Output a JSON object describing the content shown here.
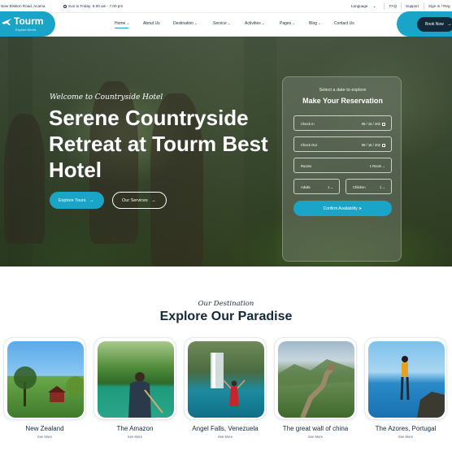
{
  "topbar": {
    "address": "New Elskton Road, Acama",
    "hours": "Sun to Friday: 8.00 am - 7.00 pm",
    "language": "Language",
    "faq": "FAQ",
    "support": "Support",
    "signin": "Sign In / Reg"
  },
  "logo": {
    "title": "Tourm",
    "tagline": "Explore World"
  },
  "nav": [
    {
      "label": "Home",
      "dropdown": true
    },
    {
      "label": "About Us",
      "dropdown": false
    },
    {
      "label": "Destination",
      "dropdown": true
    },
    {
      "label": "Service",
      "dropdown": true
    },
    {
      "label": "Activities",
      "dropdown": true
    },
    {
      "label": "Pages",
      "dropdown": true
    },
    {
      "label": "Blog",
      "dropdown": true
    },
    {
      "label": "Contact Us",
      "dropdown": false
    }
  ],
  "book_now": "Book Now",
  "hero": {
    "welcome": "Welcome to Countryside Hotel",
    "title": "Serene Countryside Retreat at Tourm Best Hotel",
    "explore_btn": "Explore Tours",
    "services_btn": "Our Services"
  },
  "reservation": {
    "subtitle": "Select a date to explore",
    "title": "Make Your Reservation",
    "check_in_label": "Check In",
    "check_in_value": "09 / 15 / 202",
    "check_out_label": "Check Out",
    "check_out_value": "09 / 16 / 202",
    "rooms_label": "Rooms",
    "rooms_value": "1 Room",
    "adults_label": "Adults",
    "adults_value": "1",
    "children_label": "Children",
    "children_value": "1",
    "confirm_btn": "Confirm Availability"
  },
  "destinations": {
    "script": "Our Destination",
    "title": "Explore Our Paradise",
    "see_more": "See More",
    "items": [
      {
        "name": "New Zealand"
      },
      {
        "name": "The Amazon"
      },
      {
        "name": "Angel Falls, Venezuela"
      },
      {
        "name": "The great wall of china"
      },
      {
        "name": "The Azores, Portugal"
      }
    ]
  },
  "colors": {
    "accent": "#1aa5c8",
    "dark": "#13293a"
  }
}
